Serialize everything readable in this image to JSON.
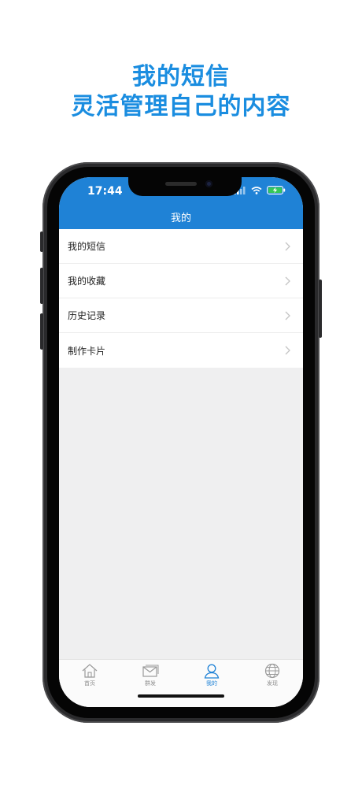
{
  "promo": {
    "line1": "我的短信",
    "line2": "灵活管理自己的内容"
  },
  "status_bar": {
    "time": "17:44",
    "icons": [
      "signal-icon",
      "wifi-icon",
      "battery-charging-icon"
    ]
  },
  "nav": {
    "title": "我的"
  },
  "menu": {
    "items": [
      {
        "label": "我的短信"
      },
      {
        "label": "我的收藏"
      },
      {
        "label": "历史记录"
      },
      {
        "label": "制作卡片"
      }
    ]
  },
  "tabbar": {
    "tabs": [
      {
        "label": "首页",
        "icon": "home-icon"
      },
      {
        "label": "群发",
        "icon": "mail-icon"
      },
      {
        "label": "我的",
        "icon": "user-icon",
        "active": true
      },
      {
        "label": "发现",
        "icon": "globe-icon"
      }
    ]
  },
  "colors": {
    "accent": "#1f82d6",
    "promo_text": "#1a8de0",
    "background": "#efeff0"
  }
}
